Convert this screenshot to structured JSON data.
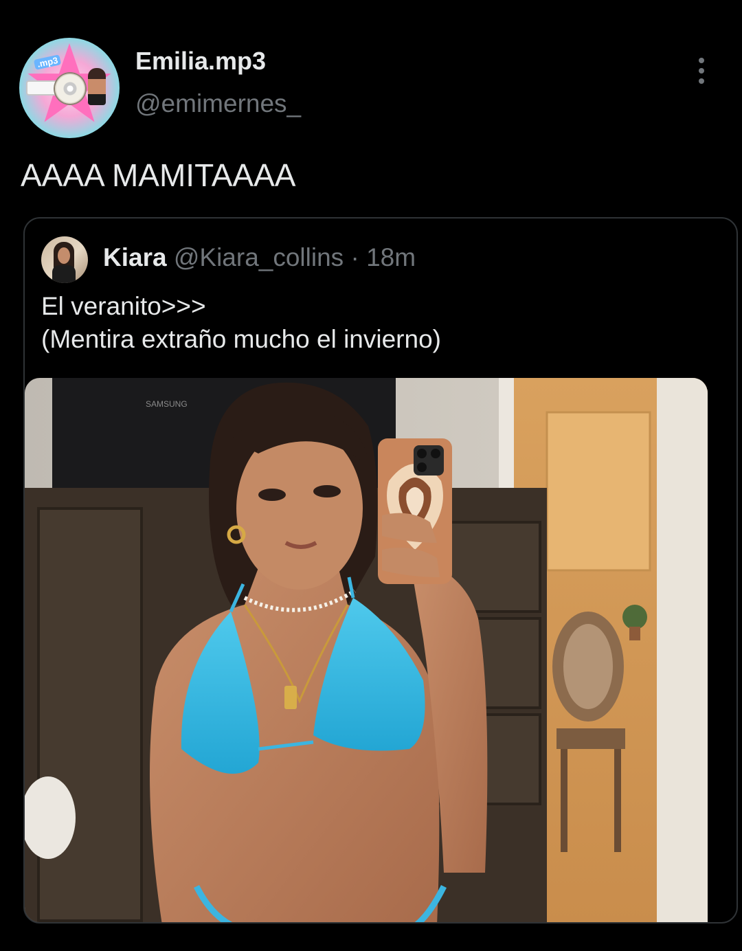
{
  "author": {
    "display_name": "Emilia.mp3",
    "handle": "@emimernes_",
    "avatar_icon": "profile-avatar-mp3-star"
  },
  "tweet": {
    "text": "AAAA MAMITAAAA"
  },
  "menu": {
    "icon": "more-vertical-icon"
  },
  "quoted_tweet": {
    "display_name": "Kiara",
    "handle": "@Kiara_collins",
    "separator": "·",
    "time": "18m",
    "text": "El veranito>>>\n(Mentira extraño mucho el invierno)",
    "avatar_icon": "profile-avatar-photo",
    "photo": {
      "description_icon": "mirror-selfie-photo",
      "tv_brand": "SAMSUNG"
    }
  },
  "colors": {
    "background": "#000000",
    "primary_text": "#e7e9ea",
    "secondary_text": "#71767b",
    "card_border": "#2f3336"
  }
}
